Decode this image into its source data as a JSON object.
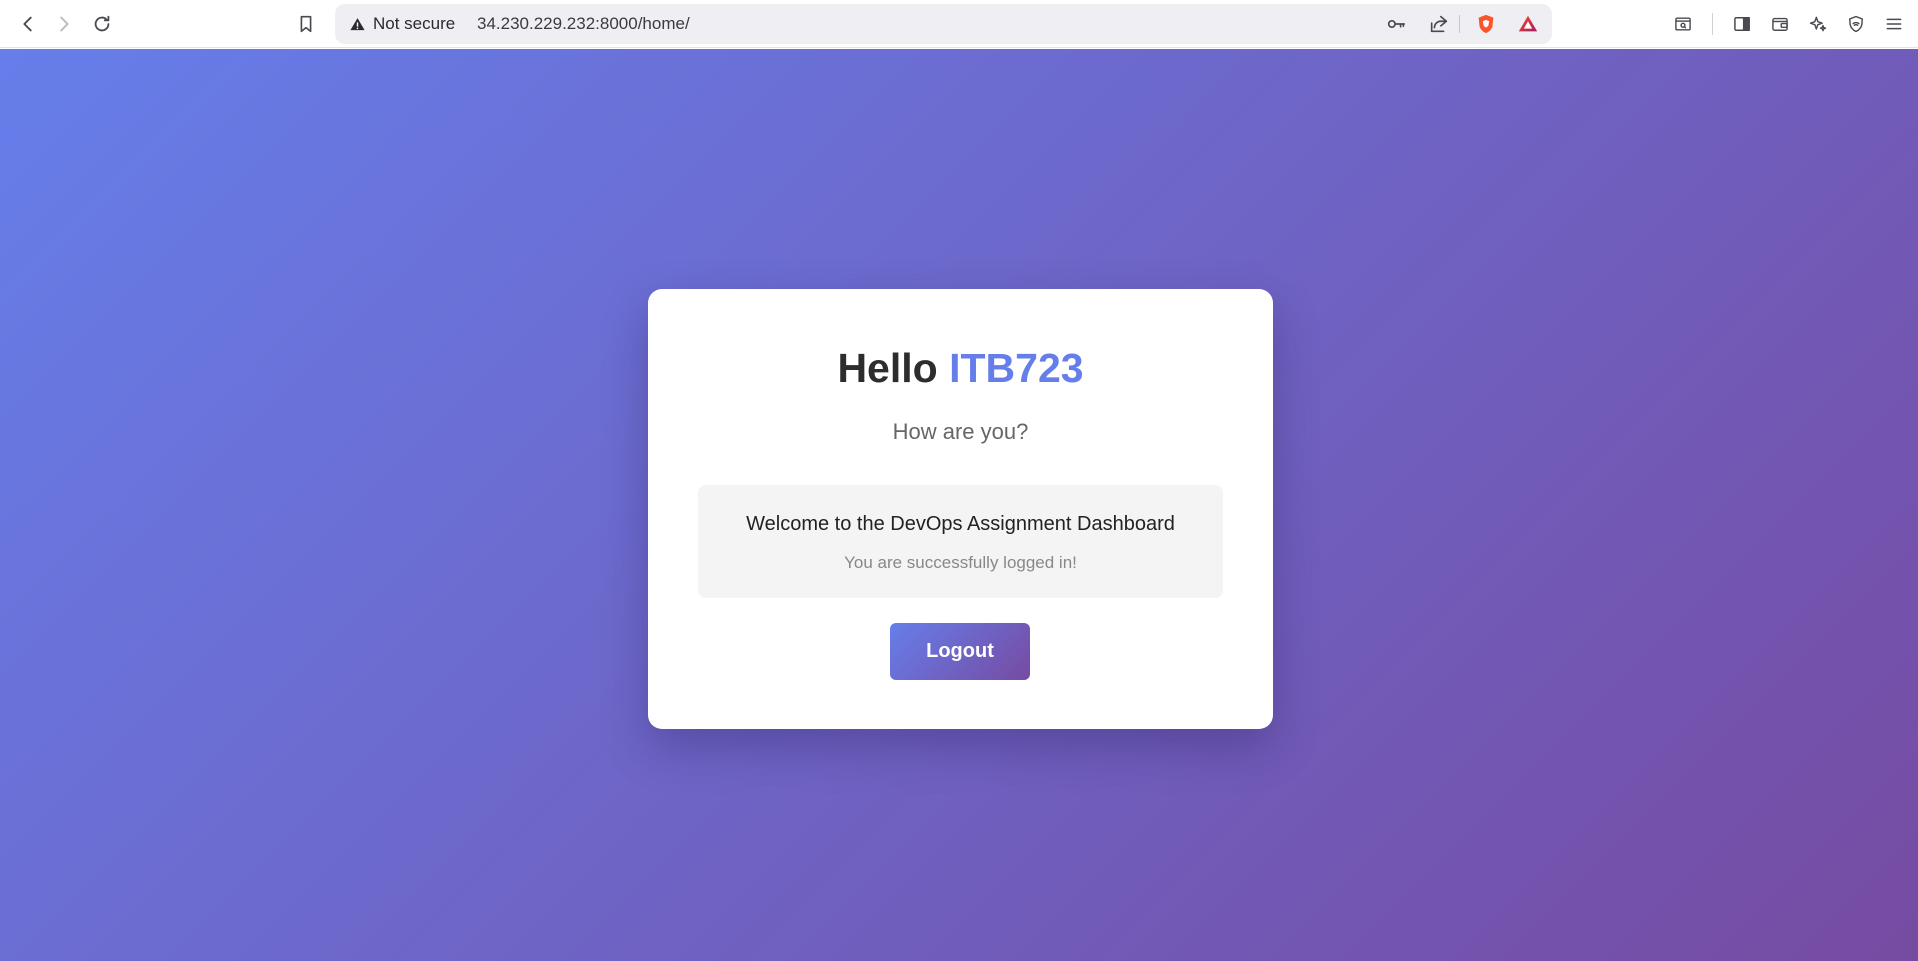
{
  "browser": {
    "security_label": "Not secure",
    "url": "34.230.229.232:8000/home/",
    "icons": {
      "back": "back-arrow-icon",
      "forward": "forward-arrow-icon",
      "reload": "reload-icon",
      "bookmark": "bookmark-icon",
      "warning": "warning-icon",
      "key": "key-icon",
      "share": "share-icon",
      "brave_shield": "brave-shield-icon",
      "brave_rewards": "brave-rewards-icon",
      "tab_search": "tab-search-icon",
      "sidebar": "sidebar-icon",
      "wallet": "wallet-icon",
      "leo": "leo-ai-icon",
      "vpn": "vpn-shield-icon",
      "menu": "menu-icon"
    }
  },
  "page": {
    "greeting_prefix": "Hello",
    "username": "ITB723",
    "subtitle": "How are you?",
    "info_title": "Welcome to the DevOps Assignment Dashboard",
    "info_subtitle": "You are successfully logged in!",
    "logout_label": "Logout"
  },
  "colors": {
    "gradient_start": "#667eea",
    "gradient_end": "#764ba2",
    "accent": "#667eea",
    "brave_orange": "#fb542b"
  }
}
